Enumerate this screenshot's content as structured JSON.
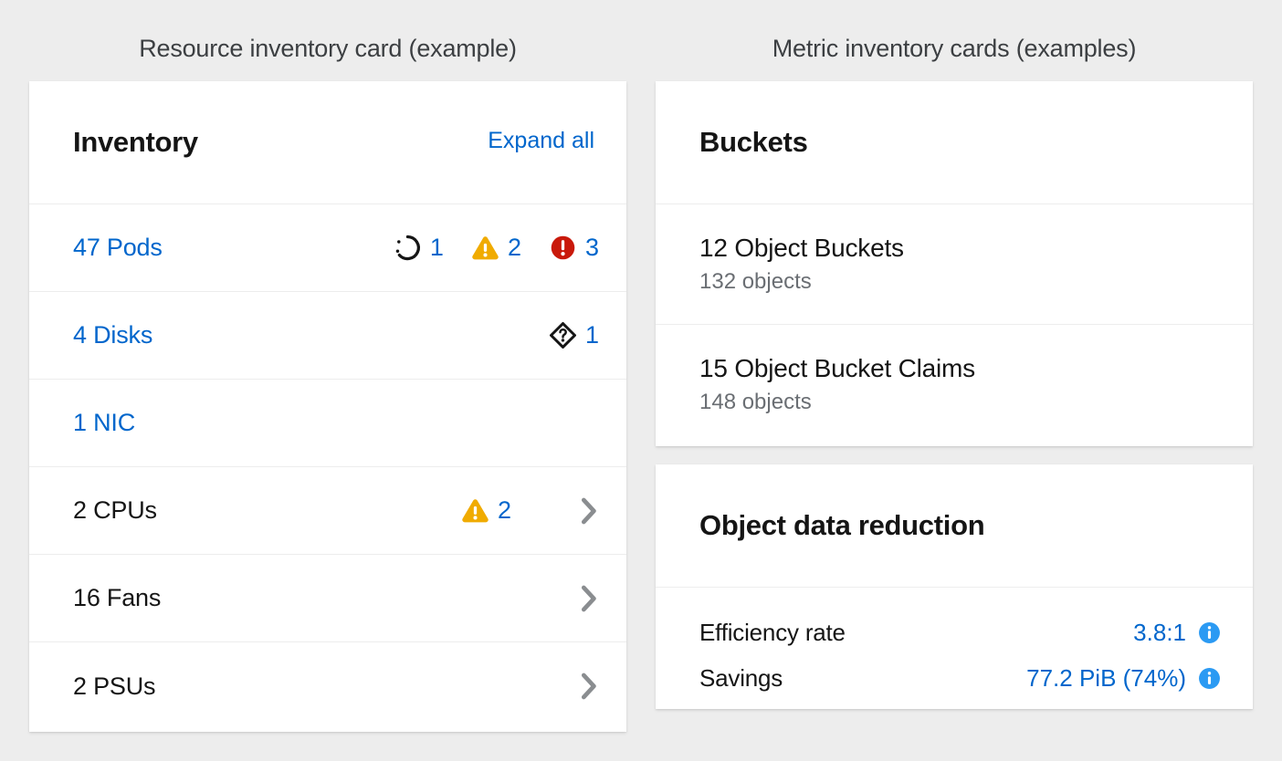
{
  "captions": {
    "left": "Resource inventory card (example)",
    "right": "Metric inventory cards (examples)"
  },
  "colors": {
    "page_background": "#ededed",
    "card_background": "#ffffff",
    "link_blue": "#0066cc",
    "info_blue": "#2b9af3",
    "warning_gold": "#f0ab00",
    "danger_red": "#c9190b",
    "unknown_black": "#151515",
    "chevron_gray": "#8a8d90",
    "muted_text": "#6a6e73"
  },
  "inventory_card": {
    "title": "Inventory",
    "expand_all_label": "Expand all",
    "rows": [
      {
        "label": "47 Pods",
        "is_link": true,
        "statuses": [
          {
            "icon": "in-progress-icon",
            "count": "1"
          },
          {
            "icon": "warning-triangle-icon",
            "count": "2"
          },
          {
            "icon": "danger-exclamation-icon",
            "count": "3"
          }
        ],
        "has_chevron": false
      },
      {
        "label": "4 Disks",
        "is_link": true,
        "statuses": [
          {
            "icon": "unknown-diamond-icon",
            "count": "1"
          }
        ],
        "has_chevron": false
      },
      {
        "label": "1 NIC",
        "is_link": true,
        "statuses": [],
        "has_chevron": false
      },
      {
        "label": "2 CPUs",
        "is_link": false,
        "statuses": [
          {
            "icon": "warning-triangle-icon",
            "count": "2"
          }
        ],
        "has_chevron": true
      },
      {
        "label": "16 Fans",
        "is_link": false,
        "statuses": [],
        "has_chevron": true
      },
      {
        "label": "2 PSUs",
        "is_link": false,
        "statuses": [],
        "has_chevron": true
      }
    ]
  },
  "buckets_card": {
    "title": "Buckets",
    "rows": [
      {
        "primary": "12 Object Buckets",
        "secondary": "132 objects"
      },
      {
        "primary": "15 Object Bucket Claims",
        "secondary": "148 objects"
      }
    ]
  },
  "reduction_card": {
    "title": "Object data reduction",
    "rows": [
      {
        "label": "Efficiency rate",
        "value": "3.8:1",
        "info_icon": "info-circle-icon"
      },
      {
        "label": "Savings",
        "value": "77.2 PiB (74%)",
        "info_icon": "info-circle-icon"
      }
    ]
  }
}
